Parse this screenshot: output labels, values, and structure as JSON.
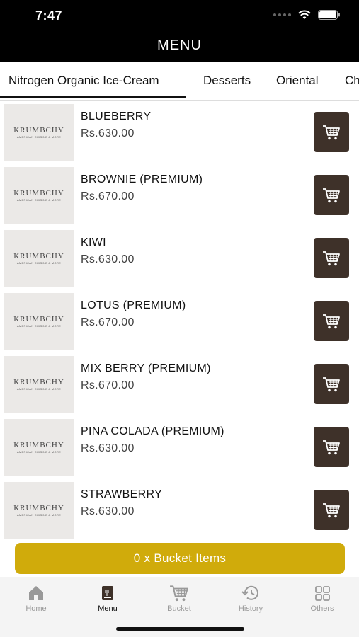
{
  "status_bar": {
    "time": "7:47",
    "icons": [
      "signal-dots-icon",
      "wifi-icon",
      "battery-icon"
    ]
  },
  "header": {
    "title": "MENU"
  },
  "tabs": [
    {
      "label": "Nitrogen Organic Ice-Cream",
      "active": true
    },
    {
      "label": "Desserts"
    },
    {
      "label": "Oriental"
    },
    {
      "label": "Ch"
    }
  ],
  "brand": {
    "logo_text": "KRUMBCHY",
    "logo_subtext": "AMERICAN CUISINE & MORE"
  },
  "products": [
    {
      "name": "BLUEBERRY",
      "price": "Rs.630.00"
    },
    {
      "name": "BROWNIE (PREMIUM)",
      "price": "Rs.670.00"
    },
    {
      "name": "KIWI",
      "price": "Rs.630.00"
    },
    {
      "name": "LOTUS (PREMIUM)",
      "price": "Rs.670.00"
    },
    {
      "name": "MIX BERRY (PREMIUM)",
      "price": "Rs.670.00"
    },
    {
      "name": "PINA COLADA (PREMIUM)",
      "price": "Rs.630.00"
    },
    {
      "name": "STRAWBERRY",
      "price": "Rs.630.00"
    }
  ],
  "bucket_bar": {
    "label": "0 x Bucket Items"
  },
  "bottom_nav": [
    {
      "label": "Home",
      "icon": "home-icon"
    },
    {
      "label": "Menu",
      "icon": "menu-icon",
      "active": true
    },
    {
      "label": "Bucket",
      "icon": "cart-icon"
    },
    {
      "label": "History",
      "icon": "history-icon"
    },
    {
      "label": "Others",
      "icon": "grid-icon"
    }
  ],
  "colors": {
    "header_bg": "#000000",
    "cart_button": "#3e3129",
    "bucket_bar": "#d0ab0b",
    "nav_inactive": "#999999",
    "nav_active": "#111111"
  }
}
